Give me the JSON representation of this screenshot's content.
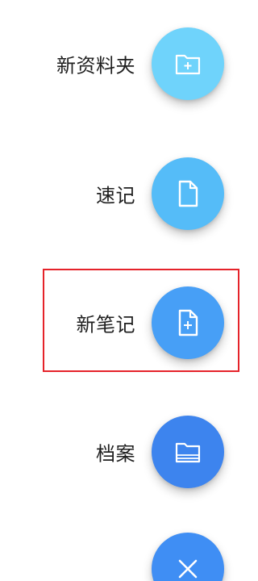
{
  "menu": {
    "items": [
      {
        "label": "新资料夹",
        "icon": "folder-add-icon",
        "color": "#6fd3fb"
      },
      {
        "label": "速记",
        "icon": "document-icon",
        "color": "#55bcf8"
      },
      {
        "label": "新笔记",
        "icon": "note-add-icon",
        "color": "#479ff6"
      },
      {
        "label": "档案",
        "icon": "archive-folder-icon",
        "color": "#3d84ee"
      }
    ],
    "close": {
      "icon": "close-icon",
      "color": "#3f8ef4"
    }
  },
  "highlight": {
    "color": "#e5232a"
  }
}
